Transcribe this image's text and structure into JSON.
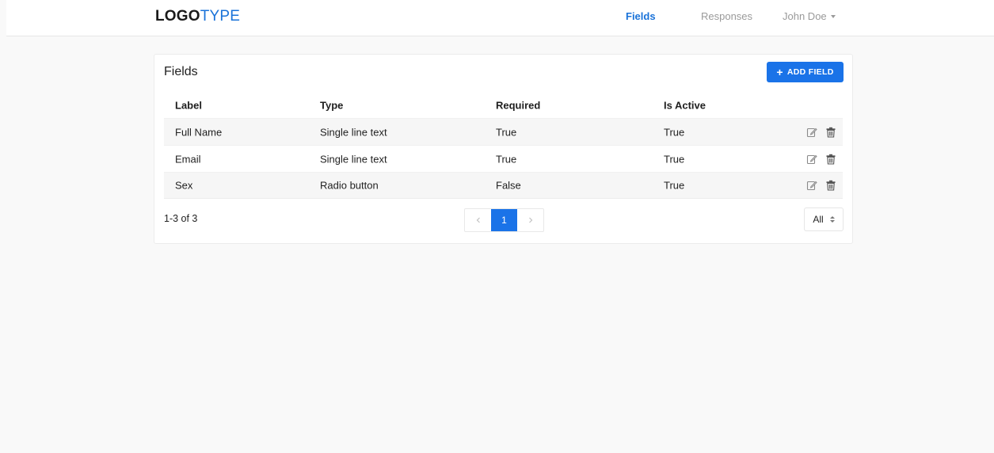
{
  "header": {
    "logo_bold": "LOGO",
    "logo_light": "TYPE",
    "nav": {
      "fields": "Fields",
      "responses": "Responses",
      "user": "John Doe"
    },
    "user_menu_icon": "chevron-down-icon"
  },
  "card": {
    "title": "Fields",
    "add_button": "ADD FIELD",
    "add_icon": "plus-icon"
  },
  "table": {
    "columns": [
      "Label",
      "Type",
      "Required",
      "Is Active"
    ],
    "rows": [
      {
        "label": "Full Name",
        "type": "Single line text",
        "required": "True",
        "active": "True"
      },
      {
        "label": "Email",
        "type": "Single line text",
        "required": "True",
        "active": "True"
      },
      {
        "label": "Sex",
        "type": "Radio button",
        "required": "False",
        "active": "True"
      }
    ],
    "row_icons": [
      "edit-icon",
      "trash-icon"
    ]
  },
  "footer": {
    "range": "1-3 of 3",
    "current_page": "1",
    "per_page": "All"
  },
  "colors": {
    "accent": "#1a73e8",
    "muted_text": "#9a9a9a",
    "page_bg": "#f9f9f9"
  }
}
